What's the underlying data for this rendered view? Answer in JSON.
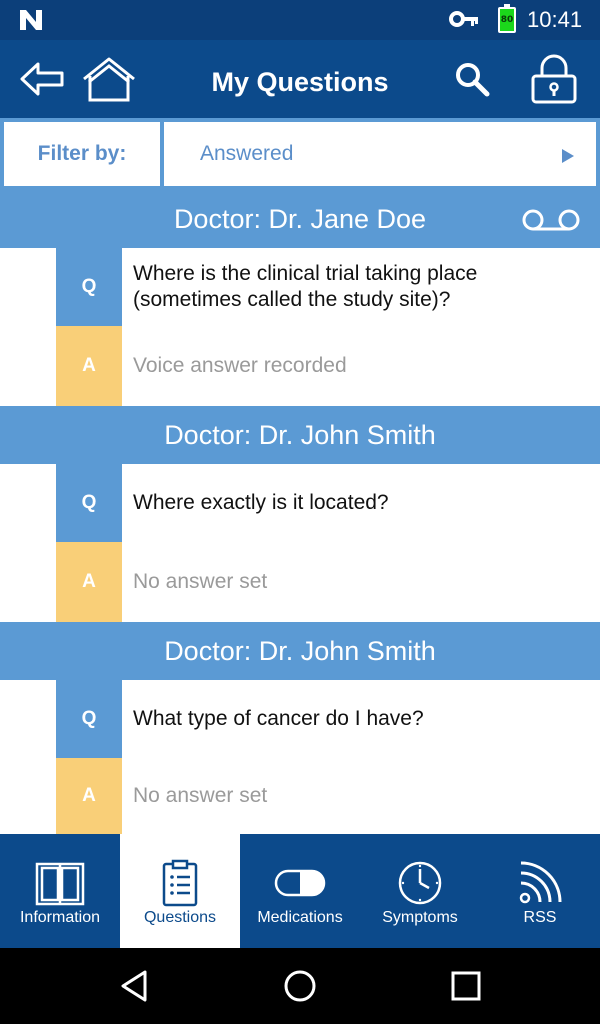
{
  "status_bar": {
    "time": "10:41",
    "battery_level": "80"
  },
  "app_bar": {
    "title": "My Questions"
  },
  "filter": {
    "label": "Filter by:",
    "value": "Answered"
  },
  "sections": [
    {
      "doctor": "Doctor: Dr. Jane Doe",
      "question": "Where is the clinical trial taking place (sometimes called the study site)?",
      "answer": "Voice answer recorded",
      "has_voice": true
    },
    {
      "doctor": "Doctor: Dr. John Smith",
      "question": "Where exactly is it located?",
      "answer": "No answer set"
    },
    {
      "doctor": "Doctor: Dr. John Smith",
      "question": "What type of cancer do I have?",
      "answer": "No answer set"
    }
  ],
  "badges": {
    "question": "Q",
    "answer": "A"
  },
  "tabs": [
    {
      "label": "Information",
      "icon": "book-icon"
    },
    {
      "label": "Questions",
      "icon": "clipboard-list-icon",
      "active": true
    },
    {
      "label": "Medications",
      "icon": "pill-icon"
    },
    {
      "label": "Symptoms",
      "icon": "clock-icon"
    },
    {
      "label": "RSS",
      "icon": "rss-icon"
    }
  ],
  "colors": {
    "primary": "#0c4a8b",
    "accent": "#5b9ad4",
    "answer_badge": "#f9cf78"
  }
}
